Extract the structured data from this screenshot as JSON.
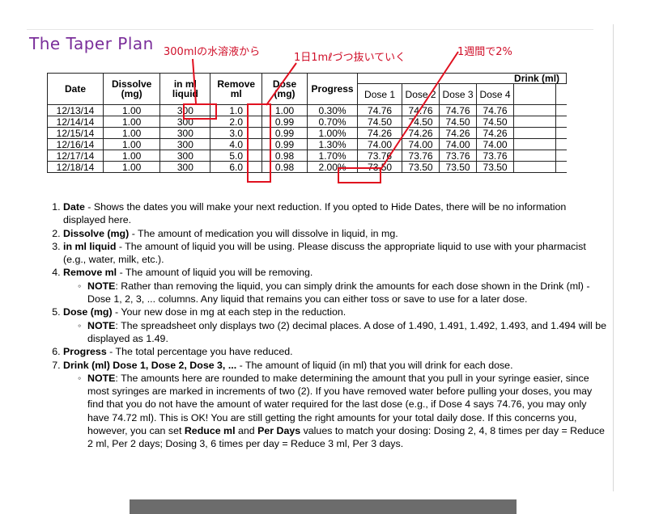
{
  "title": "The Taper Plan",
  "annotations": {
    "a1": "300mlの水溶液から",
    "a2": "1日1mℓづつ抜いていく",
    "a3": "1週間で2%"
  },
  "table": {
    "headers": [
      "Date",
      "Dissolve (mg)",
      "in ml liquid",
      "Remove ml",
      "Dose (mg)",
      "Progress"
    ],
    "drink_header": "Drink (ml)",
    "drink_cols": [
      "Dose 1",
      "Dose 2",
      "Dose 3",
      "Dose 4"
    ],
    "rows": [
      [
        "12/13/14",
        "1.00",
        "300",
        "1.0",
        "1.00",
        "0.30%",
        "74.76",
        "74.76",
        "74.76",
        "74.76"
      ],
      [
        "12/14/14",
        "1.00",
        "300",
        "2.0",
        "0.99",
        "0.70%",
        "74.50",
        "74.50",
        "74.50",
        "74.50"
      ],
      [
        "12/15/14",
        "1.00",
        "300",
        "3.0",
        "0.99",
        "1.00%",
        "74.26",
        "74.26",
        "74.26",
        "74.26"
      ],
      [
        "12/16/14",
        "1.00",
        "300",
        "4.0",
        "0.99",
        "1.30%",
        "74.00",
        "74.00",
        "74.00",
        "74.00"
      ],
      [
        "12/17/14",
        "1.00",
        "300",
        "5.0",
        "0.98",
        "1.70%",
        "73.76",
        "73.76",
        "73.76",
        "73.76"
      ],
      [
        "12/18/14",
        "1.00",
        "300",
        "6.0",
        "0.98",
        "2.00%",
        "73.50",
        "73.50",
        "73.50",
        "73.50"
      ]
    ]
  },
  "list": {
    "i1_term": "Date",
    "i1_text": " - Shows the dates you will make your next reduction. If you opted to Hide Dates, there will be no information displayed here.",
    "i2_term": "Dissolve (mg)",
    "i2_text": " - The amount of medication you will dissolve in liquid, in mg.",
    "i3_term": "in ml liquid",
    "i3_text": " - The amount of liquid you will be using. Please discuss the appropriate liquid to use with your pharmacist (e.g., water, milk, etc.).",
    "i4_term": "Remove ml",
    "i4_text": " - The amount of liquid you will be removing.",
    "i4_note_term": "NOTE",
    "i4_note_text": ": Rather than removing the liquid, you can simply drink the amounts for each dose shown in the Drink (ml) - Dose 1, 2, 3, ... columns. Any liquid that remains you can either toss or save to use for a later dose.",
    "i5_term": "Dose (mg)",
    "i5_text": " - Your new dose in mg at each step in the reduction.",
    "i5_note_term": "NOTE",
    "i5_note_text": ": The spreadsheet only displays two (2) decimal places. A dose of 1.490, 1.491, 1.492, 1.493, and 1.494 will be displayed as 1.49.",
    "i6_term": "Progress",
    "i6_text": " - The total percentage you have reduced.",
    "i7_term": "Drink (ml) Dose 1, Dose 2, Dose 3, ...",
    "i7_text": " - The amount of liquid (in ml) that you will drink for each dose.",
    "i7_note_term": "NOTE",
    "i7_note_text_a": ": The amounts here are rounded to make determining the amount that you pull in your syringe easier, since most syringes are marked in increments of two (2). If you have removed water before pulling your doses, you may find that you do not have the amount of water required for the last dose (e.g., if Dose 4 says 74.76, you may only have 74.72 ml). This is OK! You are still getting the right amounts for your total daily dose. If this concerns you, however, you can set ",
    "i7_note_b1": "Reduce ml",
    "i7_note_and": " and ",
    "i7_note_b2": "Per Days",
    "i7_note_text_c": " values to match your dosing: Dosing 2, 4, 8 times per day = Reduce 2 ml, Per 2 days; Dosing 3, 6 times per day = Reduce 3 ml, Per 3 days."
  },
  "colors": {
    "title": "#7a2e9a",
    "annotation": "#d0102a"
  }
}
